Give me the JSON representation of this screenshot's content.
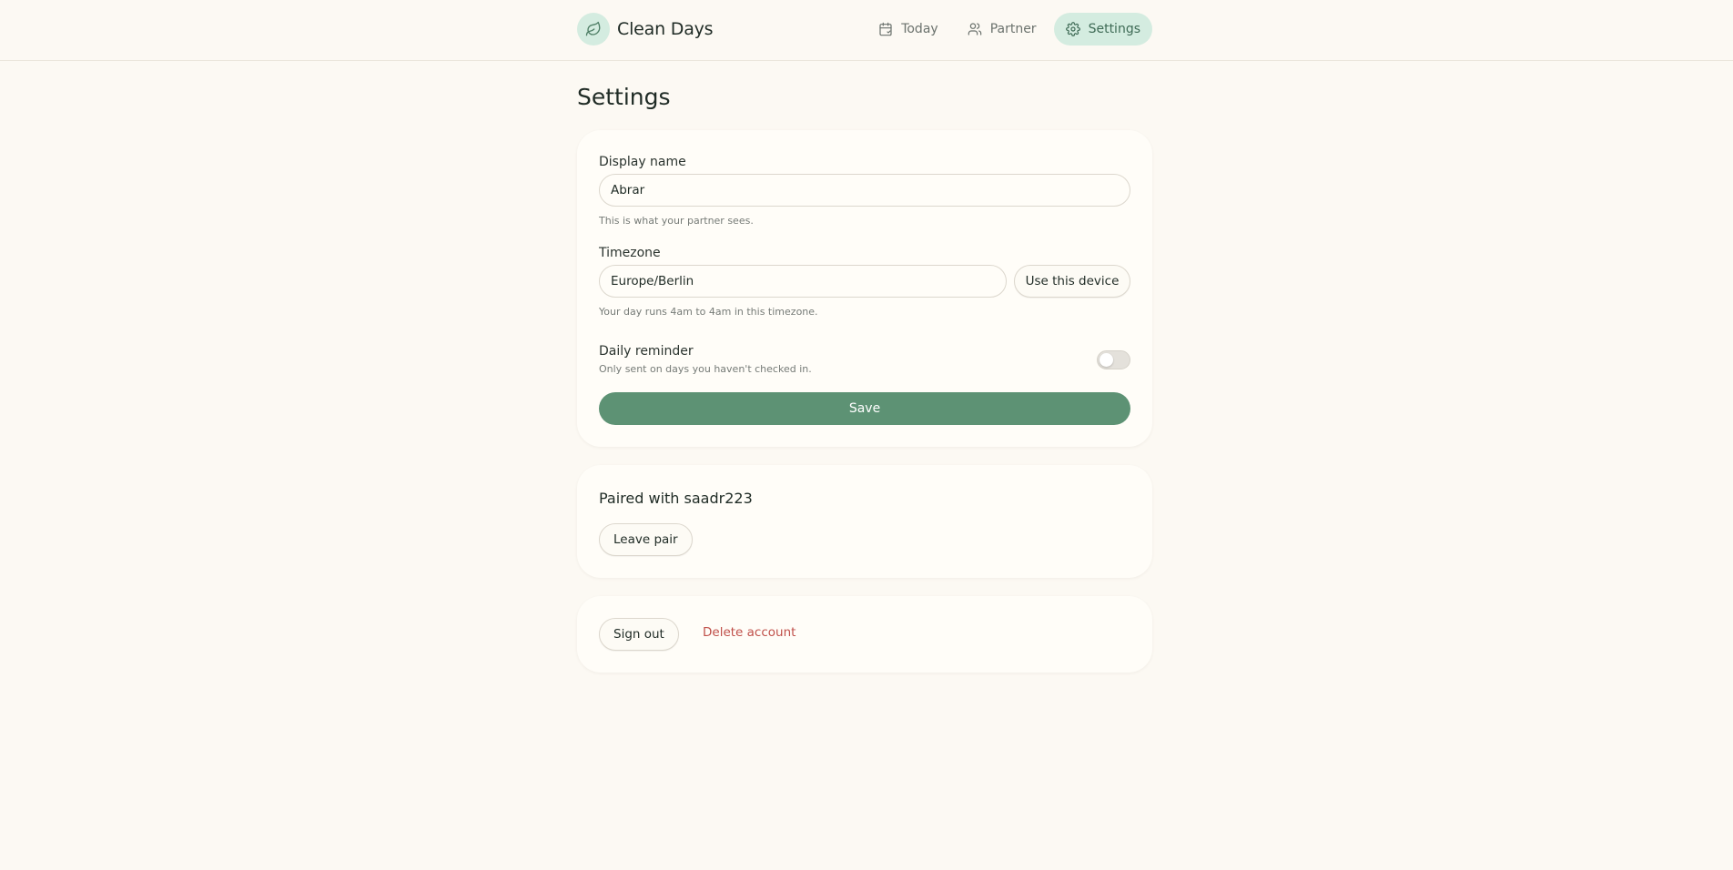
{
  "app": {
    "name": "Clean Days",
    "logo_icon": "leaf-icon"
  },
  "nav": {
    "items": [
      {
        "label": "Today",
        "icon": "calendar-icon"
      },
      {
        "label": "Partner",
        "icon": "users-icon"
      },
      {
        "label": "Settings",
        "icon": "gear-icon",
        "active": true
      }
    ]
  },
  "page": {
    "title": "Settings"
  },
  "settings": {
    "display_name": {
      "label": "Display name",
      "value": "Abrar",
      "hint": "This is what your partner sees."
    },
    "timezone": {
      "label": "Timezone",
      "value": "Europe/Berlin",
      "button_label": "Use this device",
      "hint": "Your day runs 4am to 4am in this timezone."
    },
    "daily_reminder": {
      "label": "Daily reminder",
      "hint": "Only sent on days you haven't checked in.",
      "enabled": false
    },
    "save_label": "Save"
  },
  "pair": {
    "title": "Paired with saadr223",
    "leave_label": "Leave pair"
  },
  "account": {
    "sign_out_label": "Sign out",
    "delete_label": "Delete account"
  },
  "colors": {
    "background": "#fcf9f3",
    "accent": "#5d9274",
    "accent_soft": "#d4ece0",
    "danger": "#c0504a"
  }
}
